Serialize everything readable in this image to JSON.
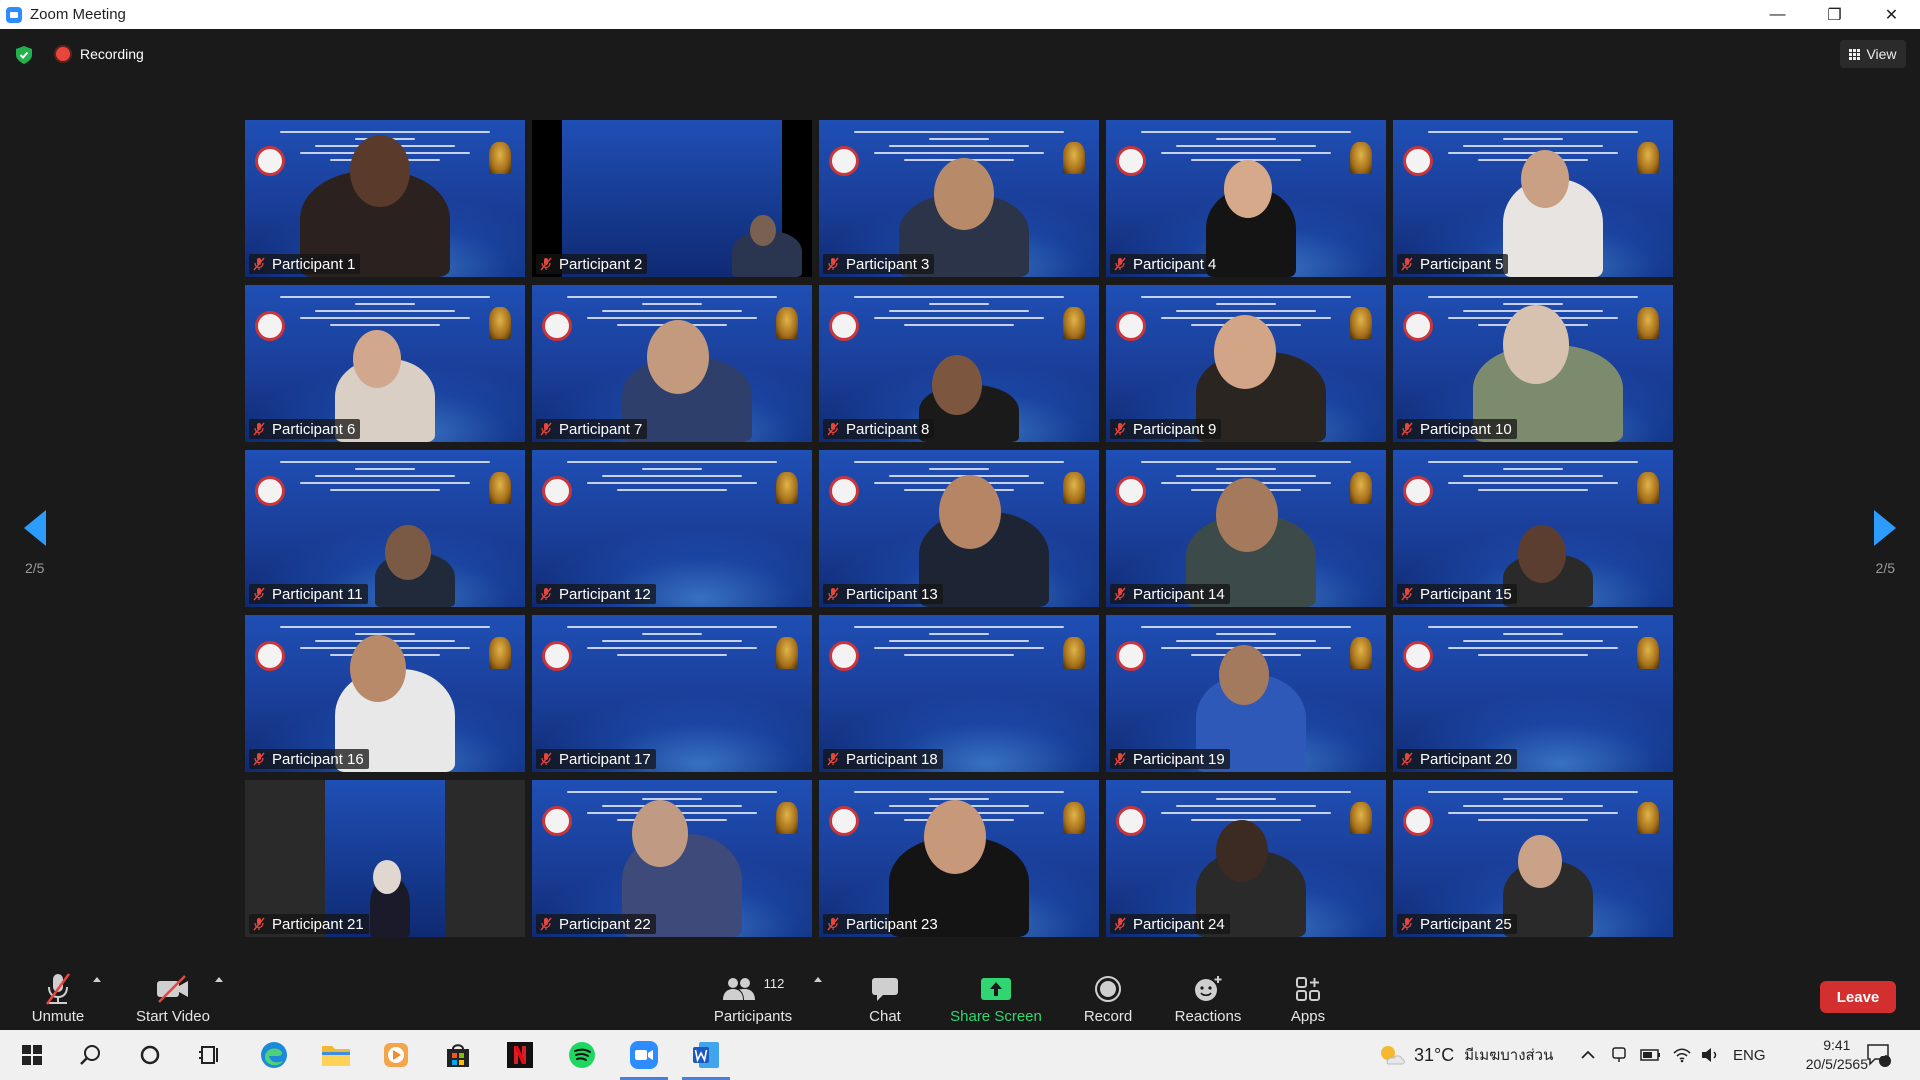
{
  "window": {
    "title": "Zoom Meeting",
    "controls": [
      "minimize-icon",
      "restore-icon",
      "close-icon"
    ]
  },
  "topbar": {
    "recording_label": "Recording",
    "view_label": "View"
  },
  "gallery": {
    "page_left": "2/5",
    "page_right": "2/5",
    "tiles": [
      {
        "name": "Participant 1",
        "muted": true
      },
      {
        "name": "Participant 2",
        "muted": true
      },
      {
        "name": "Participant 3",
        "muted": true
      },
      {
        "name": "Participant 4",
        "muted": true
      },
      {
        "name": "Participant 5",
        "muted": true
      },
      {
        "name": "Participant 6",
        "muted": true
      },
      {
        "name": "Participant 7",
        "muted": true
      },
      {
        "name": "Participant 8",
        "muted": true
      },
      {
        "name": "Participant 9",
        "muted": true
      },
      {
        "name": "Participant 10",
        "muted": true
      },
      {
        "name": "Participant 11",
        "muted": true
      },
      {
        "name": "Participant 12",
        "muted": true
      },
      {
        "name": "Participant 13",
        "muted": true
      },
      {
        "name": "Participant 14",
        "muted": true
      },
      {
        "name": "Participant 15",
        "muted": true
      },
      {
        "name": "Participant 16",
        "muted": true
      },
      {
        "name": "Participant 17",
        "muted": true
      },
      {
        "name": "Participant 18",
        "muted": true
      },
      {
        "name": "Participant 19",
        "muted": true
      },
      {
        "name": "Participant 20",
        "muted": true
      },
      {
        "name": "Participant 21",
        "muted": true
      },
      {
        "name": "Participant 22",
        "muted": true
      },
      {
        "name": "Participant 23",
        "muted": true
      },
      {
        "name": "Participant 24",
        "muted": true
      },
      {
        "name": "Participant 25",
        "muted": true
      }
    ]
  },
  "toolbar": {
    "unmute": "Unmute",
    "start_video": "Start Video",
    "participants": "Participants",
    "participant_count": "112",
    "chat": "Chat",
    "share_screen": "Share Screen",
    "record": "Record",
    "reactions": "Reactions",
    "apps": "Apps",
    "leave": "Leave"
  },
  "taskbar": {
    "temperature": "31°C",
    "weather": "มีเมฆบางส่วน",
    "language": "ENG",
    "time": "9:41",
    "date": "20/5/2565",
    "notification_count": "1"
  },
  "colors": {
    "accent": "#2d8cff",
    "leave": "#d32f2f",
    "share": "#2fd672",
    "muted_mic": "#e8463b"
  }
}
